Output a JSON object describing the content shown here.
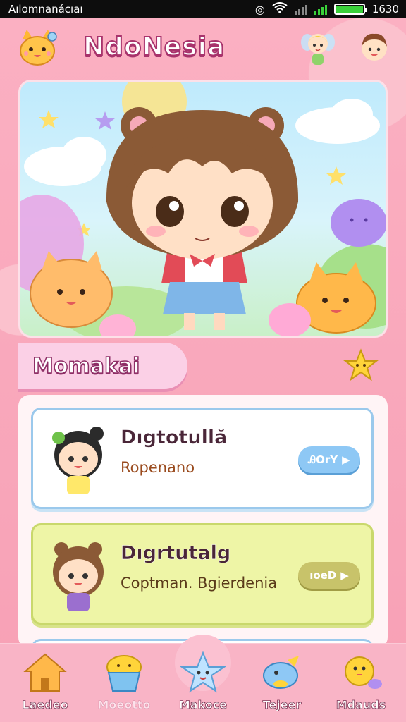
{
  "status_bar": {
    "carrier": "Aılomnanácıaı",
    "time": "1630",
    "battery_level": 1.0,
    "accent": "#3ad13a"
  },
  "header": {
    "title": "NdoNesia",
    "icons": [
      "cat-mascot-icon",
      "fairy-avatar-icon",
      "boy-avatar-icon"
    ]
  },
  "hero": {
    "image": "chibi-bear-girl-illustration"
  },
  "section": {
    "label": "Momakai"
  },
  "list": {
    "items": [
      {
        "name": "Dıgtotullă",
        "subtitle": "Ropenano",
        "button": "ᎯOrY",
        "avatar": "dark-hair-girl-avatar",
        "color": "#9bc9ec"
      },
      {
        "name": "Dıgrtutalg",
        "subtitle": "Coptman. Bgierdenia",
        "button": "ıoeD",
        "avatar": "brown-hair-girl-avatar",
        "color": "#eef5a6"
      }
    ]
  },
  "nav": {
    "items": [
      {
        "label": "Laedeo",
        "icon": "house-icon",
        "active": false
      },
      {
        "label": "Moeotto",
        "icon": "cupcake-icon",
        "active": true
      },
      {
        "label": "Makoce",
        "icon": "star-friend-icon",
        "active": false
      },
      {
        "label": "Tejeer",
        "icon": "bird-icon",
        "active": false
      },
      {
        "label": "Mdauds",
        "icon": "chick-icon",
        "active": false
      }
    ]
  },
  "colors": {
    "brand_pink": "#f8a5b8",
    "title_outline": "#a8336c"
  }
}
